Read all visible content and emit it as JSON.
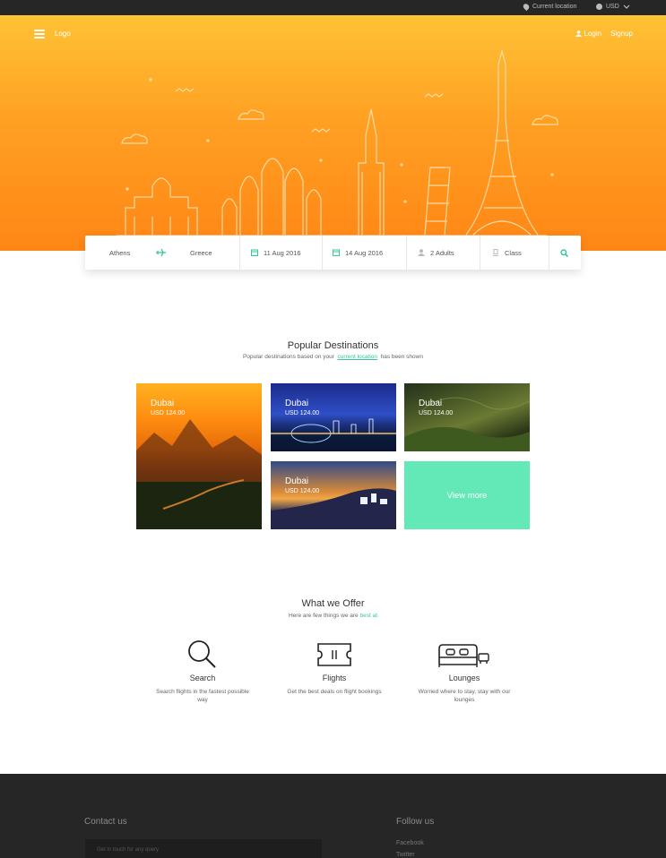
{
  "topbar": {
    "location_label": "Current location",
    "currency_label": "USD",
    "icons": [
      "pin-icon",
      "info-icon",
      "chevron-down-icon"
    ]
  },
  "header": {
    "logo": "Logo",
    "login": "Login",
    "signup": "Signup"
  },
  "search": {
    "from": "Athens",
    "to": "Greece",
    "depart": "11 Aug 2016",
    "return": "14 Aug 2016",
    "travellers": "2 Adults",
    "class": "Class"
  },
  "popular": {
    "title": "Popular Destinations",
    "subtitle_prefix": "Popular destinations based on your",
    "subtitle_link": "current location",
    "subtitle_suffix": "has been shown",
    "cards": [
      {
        "city": "Dubai",
        "price": "USD 124.00"
      },
      {
        "city": "Dubai",
        "price": "USD 124.00"
      },
      {
        "city": "Dubai",
        "price": "USD 124.00"
      },
      {
        "city": "Dubai",
        "price": "USD 124.00"
      }
    ],
    "view_more": "View more"
  },
  "offer": {
    "title": "What we Offer",
    "subtitle_prefix": "Here are few things we are",
    "subtitle_highlight": "best at",
    "items": [
      {
        "title": "Search",
        "desc": "Search flights in the fastest possible way",
        "icon": "search-icon"
      },
      {
        "title": "Flights",
        "desc": "Get the best deals on flight bookings",
        "icon": "ticket-icon"
      },
      {
        "title": "Lounges",
        "desc": "Worried where to stay, stay with our lounges",
        "icon": "bed-icon"
      }
    ]
  },
  "footer": {
    "contact_title": "Contact us",
    "contact_placeholder": "Get in touch for any query",
    "follow_title": "Follow us",
    "links": [
      "Facebook",
      "Twitter"
    ]
  },
  "colors": {
    "hero_top": "#ffc235",
    "hero_bottom": "#ff8615",
    "accent": "#39c59a",
    "view_more_bg": "#63e9b8",
    "dark": "#262626"
  }
}
